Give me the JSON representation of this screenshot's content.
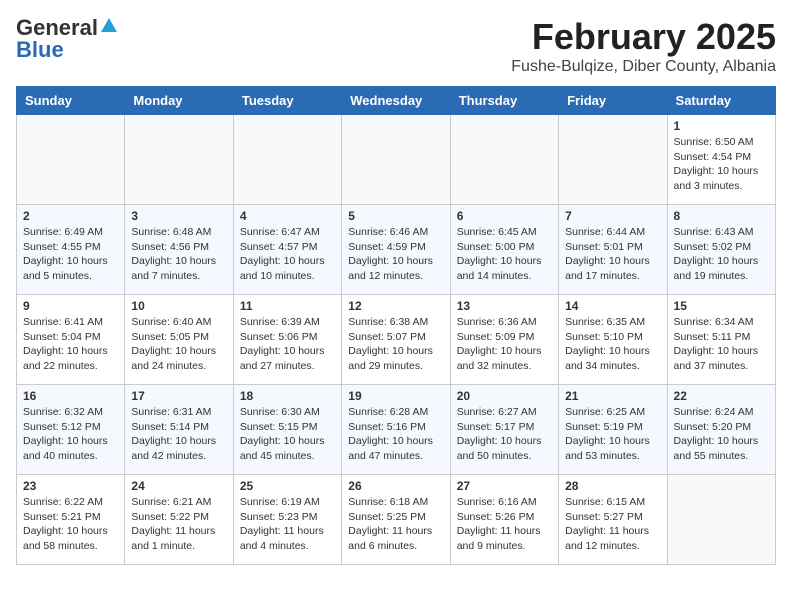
{
  "header": {
    "logo_general": "General",
    "logo_blue": "Blue",
    "title": "February 2025",
    "subtitle": "Fushe-Bulqize, Diber County, Albania"
  },
  "weekdays": [
    "Sunday",
    "Monday",
    "Tuesday",
    "Wednesday",
    "Thursday",
    "Friday",
    "Saturday"
  ],
  "weeks": [
    [
      {
        "day": "",
        "info": ""
      },
      {
        "day": "",
        "info": ""
      },
      {
        "day": "",
        "info": ""
      },
      {
        "day": "",
        "info": ""
      },
      {
        "day": "",
        "info": ""
      },
      {
        "day": "",
        "info": ""
      },
      {
        "day": "1",
        "info": "Sunrise: 6:50 AM\nSunset: 4:54 PM\nDaylight: 10 hours and 3 minutes."
      }
    ],
    [
      {
        "day": "2",
        "info": "Sunrise: 6:49 AM\nSunset: 4:55 PM\nDaylight: 10 hours and 5 minutes."
      },
      {
        "day": "3",
        "info": "Sunrise: 6:48 AM\nSunset: 4:56 PM\nDaylight: 10 hours and 7 minutes."
      },
      {
        "day": "4",
        "info": "Sunrise: 6:47 AM\nSunset: 4:57 PM\nDaylight: 10 hours and 10 minutes."
      },
      {
        "day": "5",
        "info": "Sunrise: 6:46 AM\nSunset: 4:59 PM\nDaylight: 10 hours and 12 minutes."
      },
      {
        "day": "6",
        "info": "Sunrise: 6:45 AM\nSunset: 5:00 PM\nDaylight: 10 hours and 14 minutes."
      },
      {
        "day": "7",
        "info": "Sunrise: 6:44 AM\nSunset: 5:01 PM\nDaylight: 10 hours and 17 minutes."
      },
      {
        "day": "8",
        "info": "Sunrise: 6:43 AM\nSunset: 5:02 PM\nDaylight: 10 hours and 19 minutes."
      }
    ],
    [
      {
        "day": "9",
        "info": "Sunrise: 6:41 AM\nSunset: 5:04 PM\nDaylight: 10 hours and 22 minutes."
      },
      {
        "day": "10",
        "info": "Sunrise: 6:40 AM\nSunset: 5:05 PM\nDaylight: 10 hours and 24 minutes."
      },
      {
        "day": "11",
        "info": "Sunrise: 6:39 AM\nSunset: 5:06 PM\nDaylight: 10 hours and 27 minutes."
      },
      {
        "day": "12",
        "info": "Sunrise: 6:38 AM\nSunset: 5:07 PM\nDaylight: 10 hours and 29 minutes."
      },
      {
        "day": "13",
        "info": "Sunrise: 6:36 AM\nSunset: 5:09 PM\nDaylight: 10 hours and 32 minutes."
      },
      {
        "day": "14",
        "info": "Sunrise: 6:35 AM\nSunset: 5:10 PM\nDaylight: 10 hours and 34 minutes."
      },
      {
        "day": "15",
        "info": "Sunrise: 6:34 AM\nSunset: 5:11 PM\nDaylight: 10 hours and 37 minutes."
      }
    ],
    [
      {
        "day": "16",
        "info": "Sunrise: 6:32 AM\nSunset: 5:12 PM\nDaylight: 10 hours and 40 minutes."
      },
      {
        "day": "17",
        "info": "Sunrise: 6:31 AM\nSunset: 5:14 PM\nDaylight: 10 hours and 42 minutes."
      },
      {
        "day": "18",
        "info": "Sunrise: 6:30 AM\nSunset: 5:15 PM\nDaylight: 10 hours and 45 minutes."
      },
      {
        "day": "19",
        "info": "Sunrise: 6:28 AM\nSunset: 5:16 PM\nDaylight: 10 hours and 47 minutes."
      },
      {
        "day": "20",
        "info": "Sunrise: 6:27 AM\nSunset: 5:17 PM\nDaylight: 10 hours and 50 minutes."
      },
      {
        "day": "21",
        "info": "Sunrise: 6:25 AM\nSunset: 5:19 PM\nDaylight: 10 hours and 53 minutes."
      },
      {
        "day": "22",
        "info": "Sunrise: 6:24 AM\nSunset: 5:20 PM\nDaylight: 10 hours and 55 minutes."
      }
    ],
    [
      {
        "day": "23",
        "info": "Sunrise: 6:22 AM\nSunset: 5:21 PM\nDaylight: 10 hours and 58 minutes."
      },
      {
        "day": "24",
        "info": "Sunrise: 6:21 AM\nSunset: 5:22 PM\nDaylight: 11 hours and 1 minute."
      },
      {
        "day": "25",
        "info": "Sunrise: 6:19 AM\nSunset: 5:23 PM\nDaylight: 11 hours and 4 minutes."
      },
      {
        "day": "26",
        "info": "Sunrise: 6:18 AM\nSunset: 5:25 PM\nDaylight: 11 hours and 6 minutes."
      },
      {
        "day": "27",
        "info": "Sunrise: 6:16 AM\nSunset: 5:26 PM\nDaylight: 11 hours and 9 minutes."
      },
      {
        "day": "28",
        "info": "Sunrise: 6:15 AM\nSunset: 5:27 PM\nDaylight: 11 hours and 12 minutes."
      },
      {
        "day": "",
        "info": ""
      }
    ]
  ]
}
